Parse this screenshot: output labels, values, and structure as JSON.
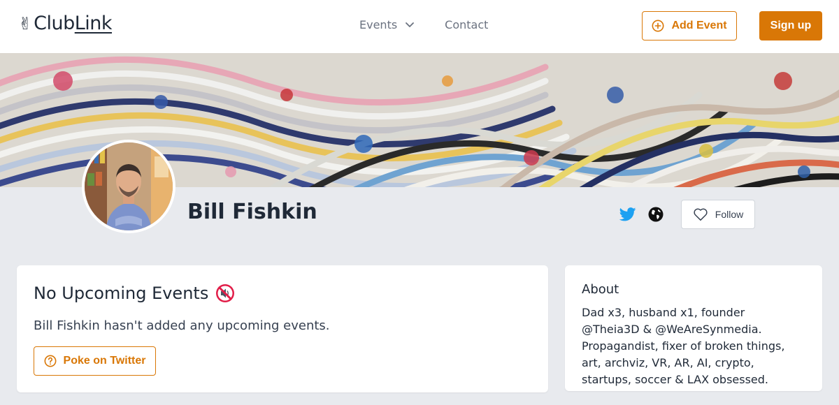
{
  "header": {
    "logo_hand": "✌",
    "logo_club": "Club",
    "logo_link": "Link",
    "nav": {
      "events_label": "Events",
      "contact_label": "Contact"
    },
    "add_event_label": "Add Event",
    "signup_label": "Sign up"
  },
  "profile": {
    "name": "Bill Fishkin",
    "follow_label": "Follow"
  },
  "events_card": {
    "title": "No Upcoming Events",
    "description": "Bill Fishkin hasn't added any upcoming events.",
    "poke_label": "Poke on Twitter"
  },
  "about_card": {
    "title": "About",
    "text": "Dad x3, husband x1, founder @Theia3D & @WeAreSynmedia. Propagandist, fixer of broken things, art, archviz, VR, AR, AI, crypto, startups, soccer & LAX obsessed."
  },
  "colors": {
    "accent": "#d97706",
    "twitter": "#1da1f2",
    "background": "#e8eaee"
  },
  "icons": {
    "add_event": "plus-circle-icon",
    "chevron": "chevron-down-icon",
    "twitter": "twitter-icon",
    "website": "globe-icon",
    "follow": "heart-icon",
    "muted": "muted-speaker-icon",
    "poke": "question-circle-icon"
  }
}
